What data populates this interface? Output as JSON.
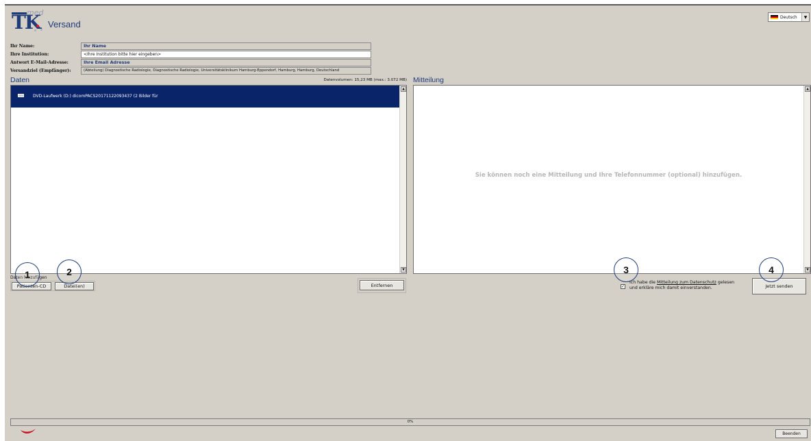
{
  "header": {
    "logo_text": "TK",
    "logo_sup": "med",
    "title": "Versand"
  },
  "language": {
    "selected": "Deutsch",
    "flag_colors": [
      "#000000",
      "#dd0000",
      "#ffce00"
    ]
  },
  "form": {
    "name_label": "Ihr Name:",
    "name_value": "Ihr Name",
    "institution_label": "Ihre Institution:",
    "institution_value": "<Ihre Institution bitte hier eingeben>",
    "email_label": "Antwort E-Mail-Adresse:",
    "email_value": "Ihre Email Adresse",
    "target_label": "Versandziel (Empfänger):",
    "target_value": "(Abteilung) Diagnostische Radiologie, Diagnostische Radiologie, Universitätsklinikum Hamburg-Eppendorf, Hamburg, Hamburg, Deutschland"
  },
  "data_section": {
    "title": "Daten",
    "volume": "Datenvolumen: 15,23 MB (max.: 3.072 MB)",
    "items": [
      {
        "label": "DVD-Laufwerk (D:) dicomPACS20171122093437  (2 Bilder für"
      }
    ],
    "add_label": "Daten hinzufügen",
    "btn_cd": "Patienten-CD",
    "btn_files": "Datei(en)",
    "btn_remove": "Entfernen"
  },
  "message_section": {
    "title": "Mitteilung",
    "placeholder": "Sie können noch eine Mitteilung und Ihre Telefonnummer (optional) hinzufügen.",
    "privacy_prefix": "Ich habe die ",
    "privacy_link": "Mitteilung zum Datenschutz",
    "privacy_suffix": " gelesen",
    "privacy_line2": "und erkläre mich damit einverstanden.",
    "privacy_checked": true,
    "btn_send": "Jetzt senden"
  },
  "annotations": [
    "1",
    "2",
    "3",
    "4"
  ],
  "footer": {
    "progress_text": "0%",
    "progress": 0,
    "btn_close": "Beenden"
  },
  "colors": {
    "brand_blue": "#1f3b78",
    "selection": "#0a246a",
    "window": "#d4d0c8"
  }
}
